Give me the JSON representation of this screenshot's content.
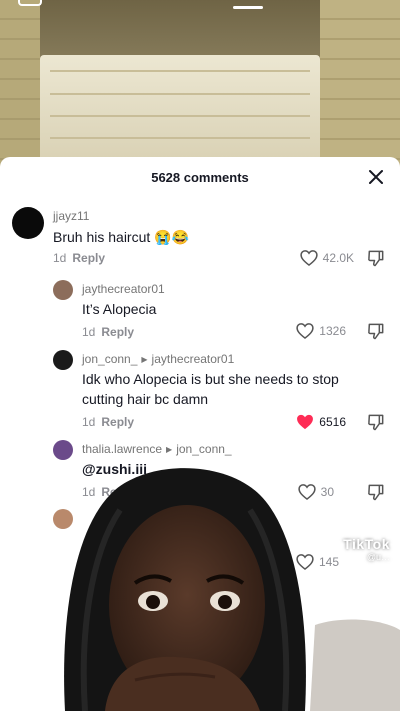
{
  "sheet": {
    "comment_count": "5628 comments",
    "close_icon": "close-icon"
  },
  "comments": [
    {
      "username": "jjayz11",
      "text": "Bruh his haircut 😭😂",
      "time": "1d",
      "reply": "Reply",
      "likes": "42.0K",
      "liked": false,
      "avatar_color": "#0a0a0a"
    },
    {
      "username": "jaythecreator01",
      "text": "It’s Alopecia",
      "time": "1d",
      "reply": "Reply",
      "likes": "1326",
      "liked": false,
      "avatar_color": "#8c6d5b"
    },
    {
      "username": "jon_conn_",
      "reply_to": "jaythecreator01",
      "text": "Idk who Alopecia is but she needs to stop cutting hair bc damn",
      "time": "1d",
      "reply": "Reply",
      "likes": "6516",
      "liked": true,
      "avatar_color": "#1a1a1a"
    },
    {
      "username": "thalia.lawrence",
      "reply_to": "jon_conn_",
      "text": "@zushi.iii",
      "time": "1d",
      "reply": "Reply",
      "likes": "30",
      "liked": false,
      "avatar_color": "#6b4a8a"
    },
    {
      "likes": "145",
      "liked": false,
      "avatar_color": "#b9896b"
    }
  ],
  "watermark": {
    "logo": "TikTok",
    "handle": "@u…"
  },
  "colors": {
    "liked_red": "#fe2c55",
    "text_dark": "#161823",
    "muted": "#8a8b91"
  }
}
